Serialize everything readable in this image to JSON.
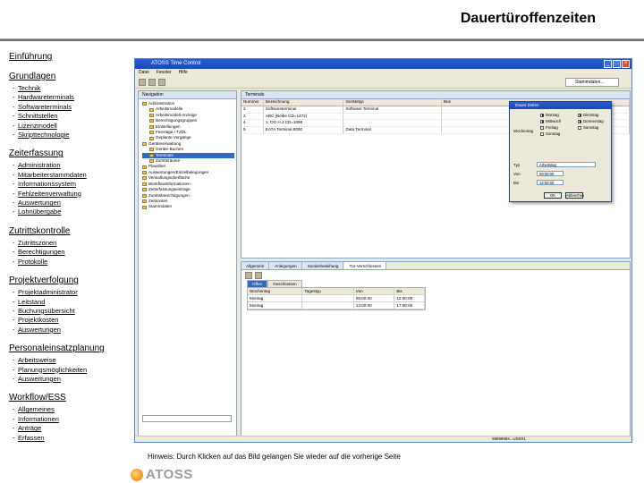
{
  "page": {
    "title": "Dauertüroffenzeiten"
  },
  "outline": [
    {
      "title": "Einführung",
      "items": []
    },
    {
      "title": "Grundlagen",
      "items": [
        "Technik",
        "Hardwareterminals",
        "Softwareterminals",
        "Schnittstellen",
        "Lizenzmodell",
        "Skripttechnologie"
      ]
    },
    {
      "title": "Zeiterfassung",
      "items": [
        "Administration",
        "Mitarbeiterstammdaten",
        "Informationssystem",
        "Fehlzeitenverwaltung",
        "Auswertungen",
        "Lohnübergabe"
      ]
    },
    {
      "title": "Zutrittskontrolle",
      "items": [
        "Zutrittszonen",
        "Berechtigungen",
        "Protokolle"
      ]
    },
    {
      "title": "Projektverfolgung",
      "items": [
        "Projektadministrator",
        "Leitstand",
        "Buchungsübersicht",
        "Projektkosten",
        "Auswertungen"
      ]
    },
    {
      "title": "Personaleinsatzplanung",
      "items": [
        "Arbeitsweise",
        "Planungsmöglichkeiten",
        "Auswertungen"
      ]
    },
    {
      "title": "Workflow/ESS",
      "items": [
        "Allgemeines",
        "Informationen",
        "Anträge",
        "Erfassen"
      ]
    }
  ],
  "app": {
    "window_title": "ATOSS Time Control",
    "menu": [
      "Datei",
      "Fenster",
      "Hilfe"
    ],
    "perspective": "Stammdaten...",
    "nav_tab": "Navigation",
    "tree": [
      {
        "label": "Administration",
        "selected": false
      },
      {
        "label": "Arbeitsmodelle",
        "selected": false
      },
      {
        "label": "Arbeitsmodell-Anzeige",
        "selected": false
      },
      {
        "label": "Berechtigungsgruppen",
        "selected": false
      },
      {
        "label": "Einstellungen",
        "selected": false
      },
      {
        "label": "Feiertage / TZDL",
        "selected": false
      },
      {
        "label": "Geplante Vorgänge",
        "selected": false
      },
      {
        "label": "Geräteverwaltung",
        "selected": false
      },
      {
        "label": "Geräte-Buchen",
        "selected": false
      },
      {
        "label": "Terminals",
        "selected": true
      },
      {
        "label": "Zutrittsräume",
        "selected": false
      },
      {
        "label": "Plausiber",
        "selected": false
      },
      {
        "label": "Auswertungen/Einzelbelegungen",
        "selected": false
      },
      {
        "label": "Verwaltungsoberfläche",
        "selected": false
      },
      {
        "label": "Workflowinformationen",
        "selected": false
      },
      {
        "label": "Zeiterfassungseinträge",
        "selected": false
      },
      {
        "label": "Zutrittsberechtigungen",
        "selected": false
      },
      {
        "label": "Zeitkonten",
        "selected": false
      },
      {
        "label": "Stammdaten",
        "selected": false
      }
    ],
    "editor_tab": "Terminals",
    "grid_columns": [
      "Nummer",
      "Bezeichnung",
      "Gerätetyp",
      "Bus"
    ],
    "grid_rows": [
      [
        "2",
        "Softwareterminal",
        "Software Terminal",
        ""
      ],
      [
        "3",
        "ABC (Belbe CD=1472)",
        "",
        ""
      ],
      [
        "4",
        "1, OG H.J.CD=1086",
        "",
        ""
      ],
      [
        "5",
        "EATA Terminal 8000",
        "Data Terminal",
        ""
      ]
    ],
    "dialog": {
      "title": "Dauer Zeiten",
      "weekday_label": "Wochentag",
      "days_left": [
        {
          "label": "Montag",
          "checked": true
        },
        {
          "label": "Mittwoch",
          "checked": true
        },
        {
          "label": "Freitag",
          "checked": false
        },
        {
          "label": "Sonntag",
          "checked": false
        }
      ],
      "days_right": [
        {
          "label": "Dienstag",
          "checked": true
        },
        {
          "label": "Donnerstag",
          "checked": true
        },
        {
          "label": "Samstag",
          "checked": false
        }
      ],
      "type_label": "Typ",
      "type_value": "Arbeitstag",
      "from_label": "Von",
      "from_value": "08:00:00",
      "to_label": "Bis",
      "to_value": "12:00:00",
      "ok": "OK",
      "cancel": "Abbrechen"
    },
    "lower_tabs": [
      "Allgemein",
      "Anlegungen",
      "Sonderbeleihung",
      "Tür-Verschlossen"
    ],
    "lower_active_tab": 3,
    "subtabs": [
      "Offen",
      "Geschlossen"
    ],
    "lower_columns": [
      "Wochentag",
      "Tagestyp",
      "Von",
      "Bis"
    ],
    "lower_rows": [
      [
        "Montag",
        "",
        "08:00:00",
        "12:00:00"
      ],
      [
        "Montag",
        "",
        "13:00:00",
        "17:00:00"
      ]
    ],
    "status_text": "99999993...USER1"
  },
  "footer": {
    "hint": "Hinweis: Durch Klicken auf das Bild gelangen Sie wieder auf die vorherige Seite",
    "logo_text": "ATOSS"
  }
}
